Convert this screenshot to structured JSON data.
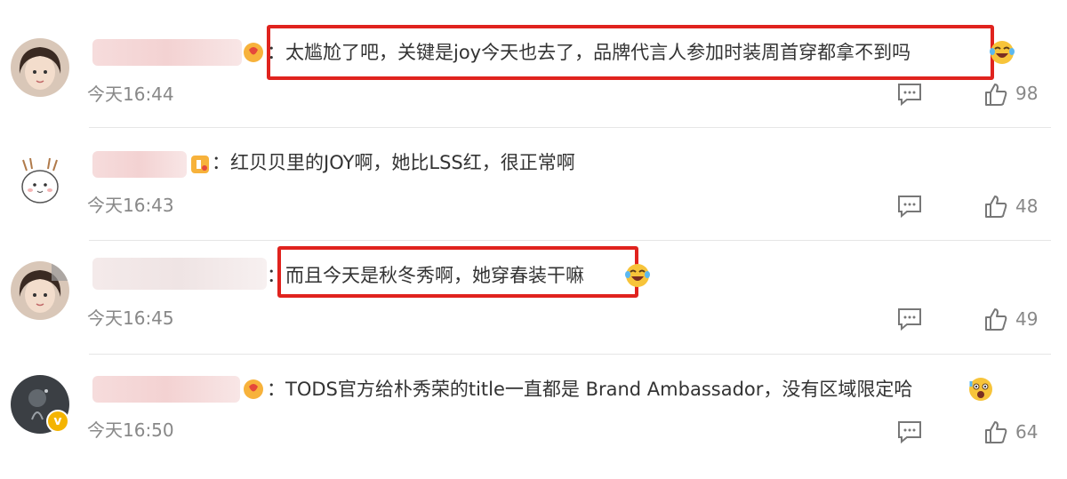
{
  "comments": [
    {
      "text": "：太尴尬了吧，关键是joy今天也去了，品牌代言人参加时装周首穿都拿不到吗",
      "time": "今天16:44",
      "likes": "98",
      "emoji": "laugh-cry-emoji",
      "highlighted": true
    },
    {
      "text": "：红贝贝里的JOY啊，她比LSS红，很正常啊",
      "time": "今天16:43",
      "likes": "48",
      "emoji": null,
      "highlighted": false
    },
    {
      "text": "：而且今天是秋冬秀啊，她穿春装干嘛",
      "time": "今天16:45",
      "likes": "49",
      "emoji": "laugh-cry-emoji",
      "highlighted": true
    },
    {
      "text": "：TODS官方给朴秀荣的title一直都是 Brand Ambassador，没有区域限定哈",
      "time": "今天16:50",
      "likes": "64",
      "emoji": "scared-emoji",
      "highlighted": false
    }
  ],
  "verified_badge_glyph": "v",
  "colors": {
    "highlight_border": "#e0231e",
    "meta_text": "#888888",
    "verified_badge": "#f4b400"
  }
}
